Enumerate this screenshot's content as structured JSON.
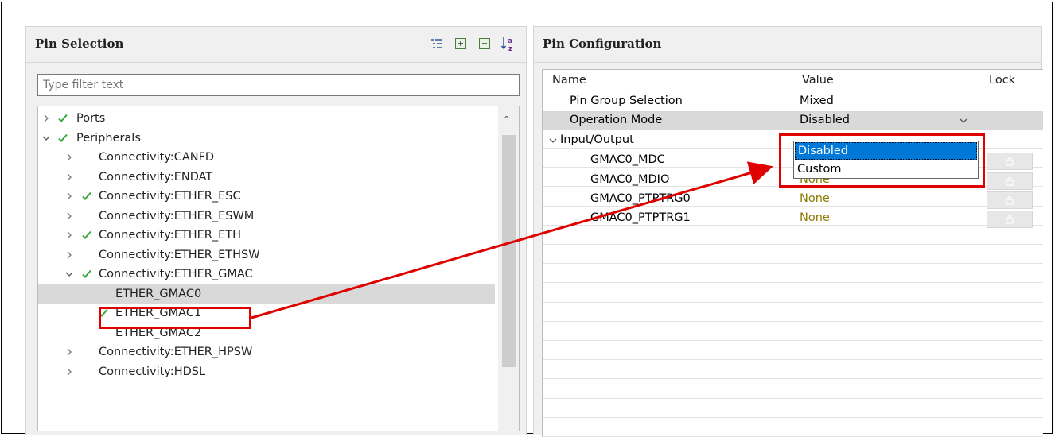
{
  "left_panel": {
    "title": "Pin Selection",
    "toolbar": [
      "show-list-icon",
      "expand-all-icon",
      "collapse-all-icon",
      "sort-az-icon"
    ],
    "filter": {
      "value": "",
      "placeholder": "Type filter text"
    },
    "tree": [
      {
        "label": "Ports",
        "expand": "collapsed",
        "checked": true,
        "level": 0
      },
      {
        "label": "Peripherals",
        "expand": "expanded",
        "checked": true,
        "level": 0
      },
      {
        "label": "Connectivity:CANFD",
        "expand": "collapsed",
        "checked": false,
        "level": 1
      },
      {
        "label": "Connectivity:ENDAT",
        "expand": "collapsed",
        "checked": false,
        "level": 1
      },
      {
        "label": "Connectivity:ETHER_ESC",
        "expand": "collapsed",
        "checked": true,
        "level": 1
      },
      {
        "label": "Connectivity:ETHER_ESWM",
        "expand": "collapsed",
        "checked": false,
        "level": 1
      },
      {
        "label": "Connectivity:ETHER_ETH",
        "expand": "collapsed",
        "checked": true,
        "level": 1
      },
      {
        "label": "Connectivity:ETHER_ETHSW",
        "expand": "collapsed",
        "checked": false,
        "level": 1
      },
      {
        "label": "Connectivity:ETHER_GMAC",
        "expand": "expanded",
        "checked": true,
        "level": 1
      },
      {
        "label": "ETHER_GMAC0",
        "expand": "none",
        "checked": false,
        "level": 2,
        "selected": true
      },
      {
        "label": "ETHER_GMAC1",
        "expand": "none",
        "checked": true,
        "level": 2
      },
      {
        "label": "ETHER_GMAC2",
        "expand": "none",
        "checked": false,
        "level": 2
      },
      {
        "label": "Connectivity:ETHER_HPSW",
        "expand": "collapsed",
        "checked": false,
        "level": 1
      },
      {
        "label": "Connectivity:HDSL",
        "expand": "collapsed",
        "checked": false,
        "level": 1
      }
    ]
  },
  "right_panel": {
    "title": "Pin Configuration",
    "columns": [
      "Name",
      "Value",
      "Lock"
    ],
    "rows": [
      {
        "name": "Pin Group Selection",
        "value": "Mixed",
        "indent": 1
      },
      {
        "name": "Operation Mode",
        "value": "Disabled",
        "indent": 1,
        "highlighted": true,
        "combo": true
      },
      {
        "name": "Input/Output",
        "value": "",
        "indent": 0,
        "expand": "expanded"
      },
      {
        "name": "GMAC0_MDC",
        "value": "",
        "indent": 2,
        "lock": true
      },
      {
        "name": "GMAC0_MDIO",
        "value": "None",
        "indent": 2,
        "lock": true
      },
      {
        "name": "GMAC0_PTPTRG0",
        "value": "None",
        "indent": 2,
        "lock": true
      },
      {
        "name": "GMAC0_PTPTRG1",
        "value": "None",
        "indent": 2,
        "lock": true
      }
    ],
    "dropdown_options": [
      {
        "label": "Disabled",
        "selected": true
      },
      {
        "label": "Custom",
        "selected": false
      }
    ]
  },
  "colors": {
    "check": "#3aa83a",
    "callout": "#e00000",
    "none_value": "#8a7a00",
    "selection": "#0078d7"
  }
}
